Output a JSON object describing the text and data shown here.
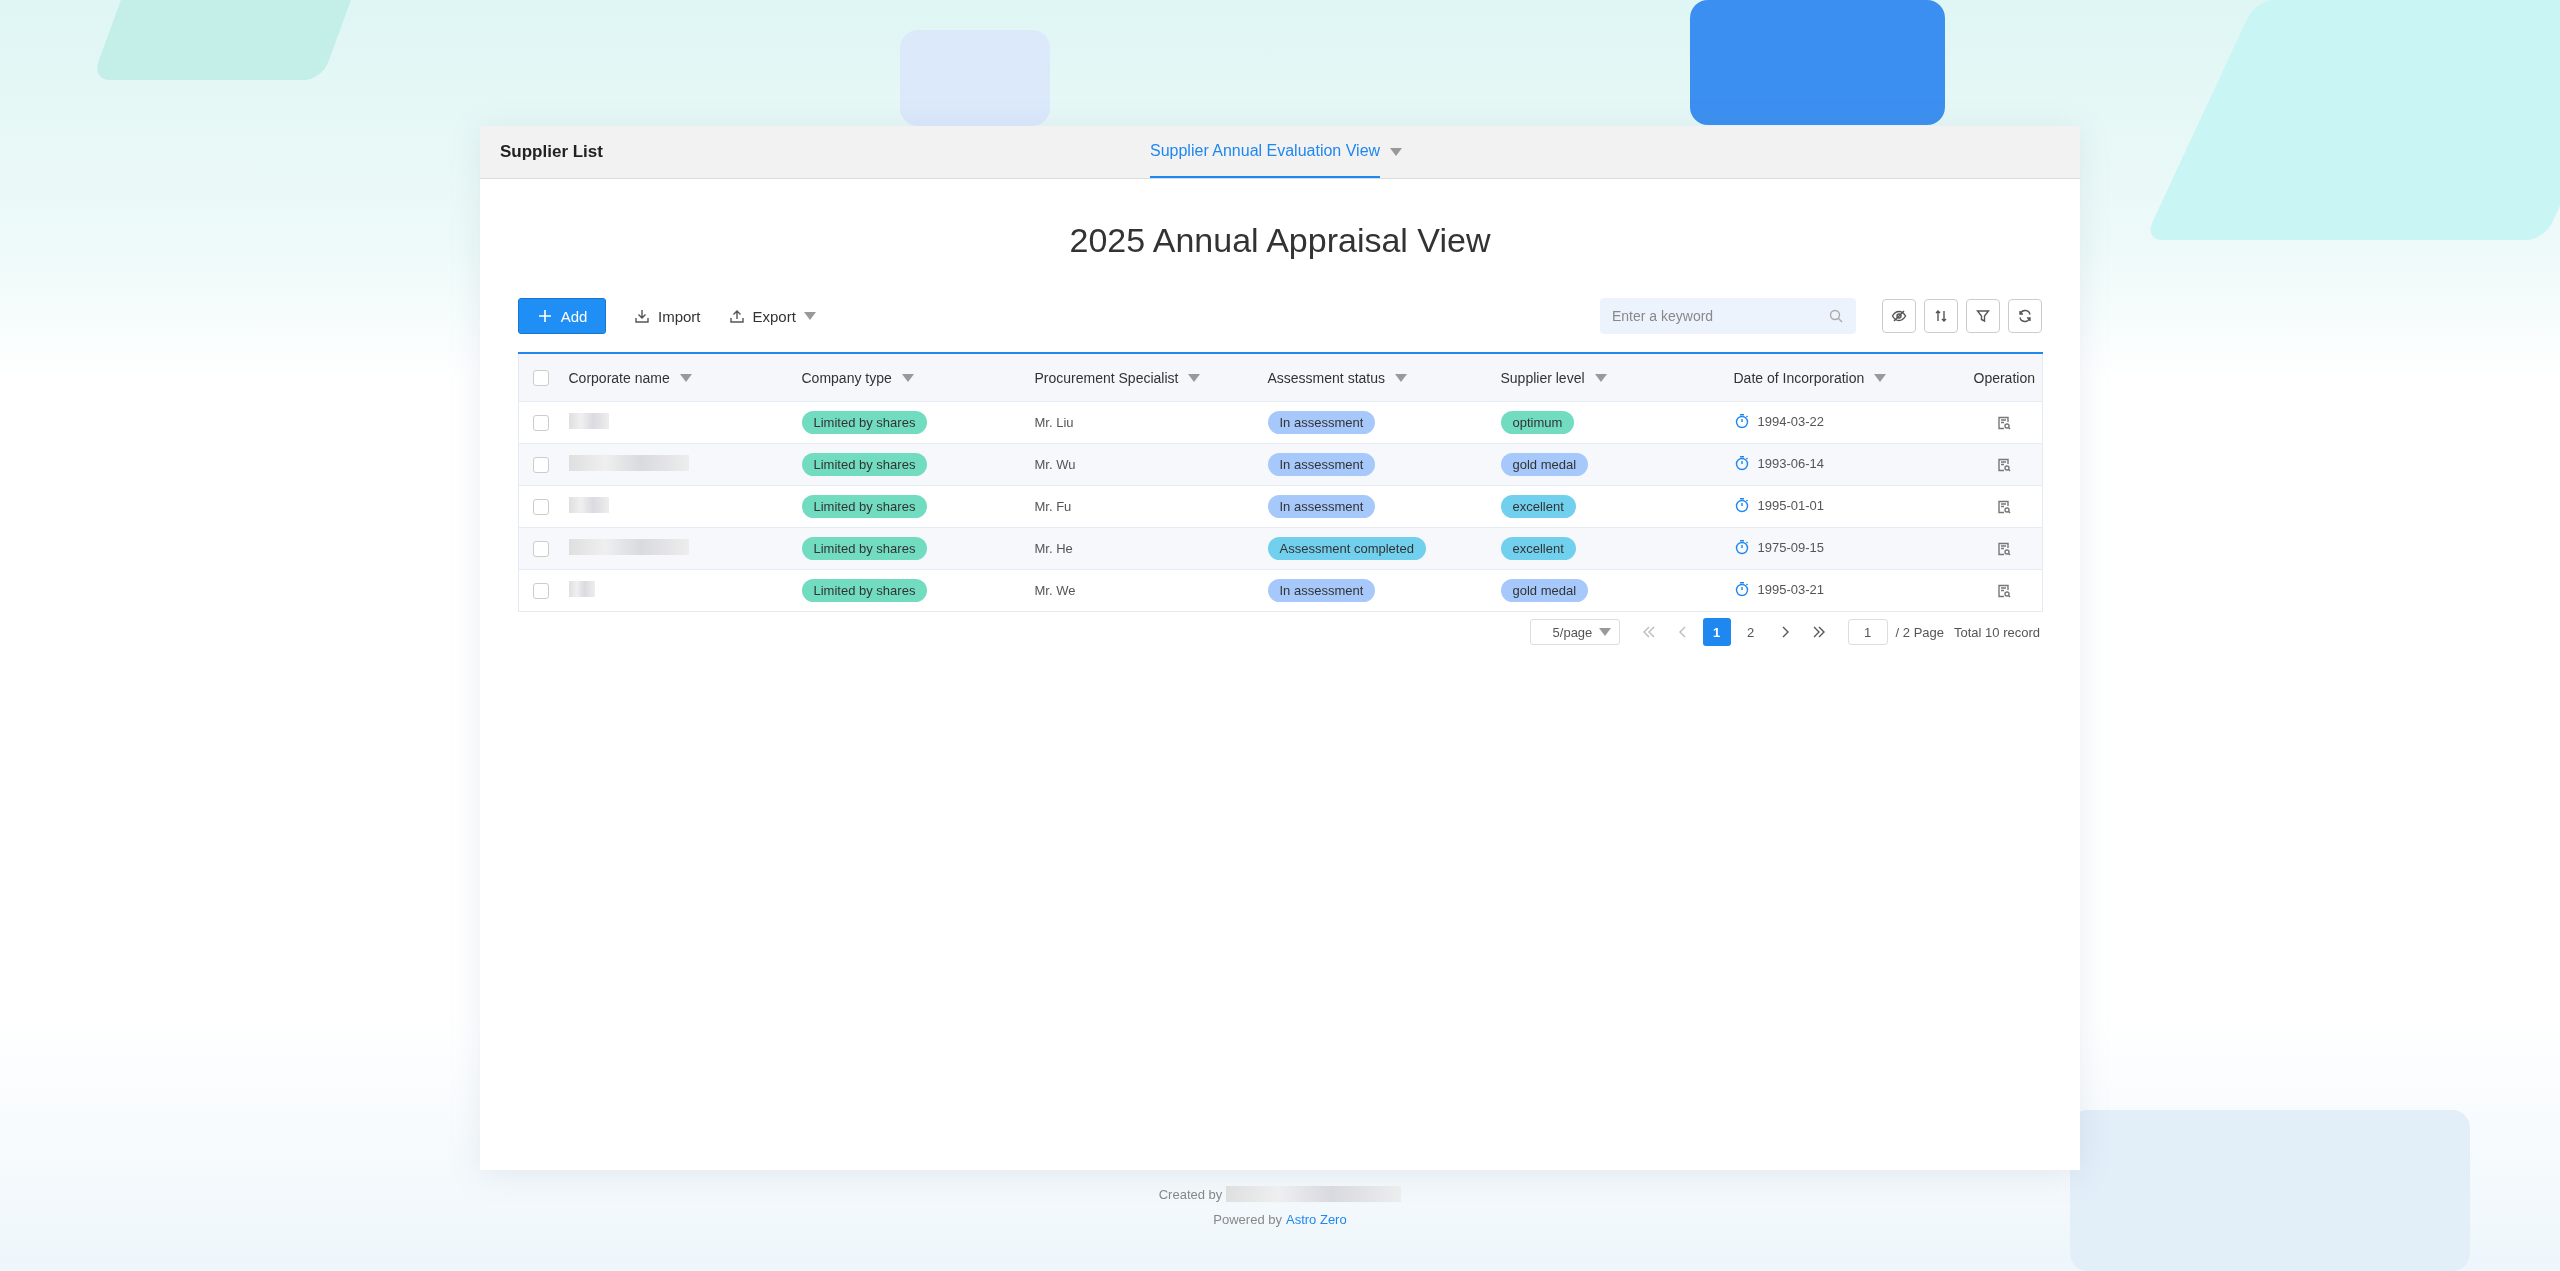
{
  "header": {
    "title": "Supplier List",
    "view_tab": {
      "label": "Supplier Annual Evaluation View",
      "selected": true
    }
  },
  "page_title": "2025 Annual Appraisal View",
  "toolbar": {
    "add": "Add",
    "import": "Import",
    "export": "Export",
    "search": {
      "placeholder": "Enter a keyword"
    }
  },
  "table": {
    "all_checked": false,
    "columns": [
      {
        "label": "Corporate name",
        "sortable": true
      },
      {
        "label": "Company type",
        "sortable": true
      },
      {
        "label": "Procurement Specialist",
        "sortable": true
      },
      {
        "label": "Assessment status",
        "sortable": true
      },
      {
        "label": "Supplier level",
        "sortable": true
      },
      {
        "label": "Date of Incorporation",
        "sortable": true
      },
      {
        "label": "Operation",
        "sortable": false
      }
    ],
    "rows": [
      {
        "checked": false,
        "company_type": {
          "text": "Limited by shares",
          "color": "#72dcc0"
        },
        "specialist": "Mr. Liu",
        "status": {
          "text": "In assessment",
          "color": "#a6c8fb"
        },
        "level": {
          "text": "optimum",
          "color": "#72dcc0"
        },
        "date": "1994-03-22"
      },
      {
        "checked": false,
        "company_type": {
          "text": "Limited by shares",
          "color": "#72dcc0"
        },
        "specialist": "Mr. Wu",
        "status": {
          "text": "In assessment",
          "color": "#a6c8fb"
        },
        "level": {
          "text": "gold medal",
          "color": "#a6c8fb"
        },
        "date": "1993-06-14"
      },
      {
        "checked": false,
        "company_type": {
          "text": "Limited by shares",
          "color": "#72dcc0"
        },
        "specialist": "Mr. Fu",
        "status": {
          "text": "In assessment",
          "color": "#a6c8fb"
        },
        "level": {
          "text": "excellent",
          "color": "#72d0ef"
        },
        "date": "1995-01-01"
      },
      {
        "checked": false,
        "company_type": {
          "text": "Limited by shares",
          "color": "#72dcc0"
        },
        "specialist": "Mr. He",
        "status": {
          "text": "Assessment completed",
          "color": "#72d0ef"
        },
        "level": {
          "text": "excellent",
          "color": "#72d0ef"
        },
        "date": "1975-09-15"
      },
      {
        "checked": false,
        "company_type": {
          "text": "Limited by shares",
          "color": "#72dcc0"
        },
        "specialist": "Mr. We",
        "status": {
          "text": "In assessment",
          "color": "#a6c8fb"
        },
        "level": {
          "text": "gold medal",
          "color": "#a6c8fb"
        },
        "date": "1995-03-21"
      }
    ]
  },
  "pagination": {
    "page_size": "5/page",
    "pages": [
      {
        "label": "1",
        "selected": true
      },
      {
        "label": "2",
        "selected": false
      }
    ],
    "jump_value": "1",
    "page_total": "/ 2 Page",
    "total": "Total 10 record"
  },
  "footer": {
    "created_by": "Created by",
    "powered_by": "Powered by",
    "link": "Astro Zero"
  }
}
